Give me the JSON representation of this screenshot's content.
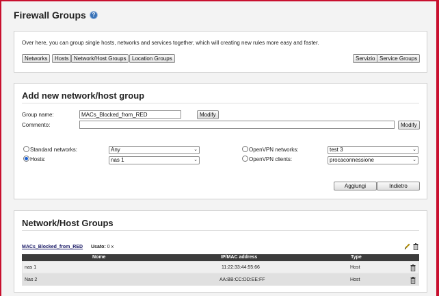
{
  "page": {
    "title": "Firewall Groups",
    "help_symbol": "?"
  },
  "intro": {
    "text": "Over here, you can group single hosts, networks and services together, which will creating new rules more easy and faster.",
    "left_buttons": [
      "Networks",
      "Hosts",
      "Network/Host Groups",
      "Location Groups"
    ],
    "right_buttons": [
      "Servizio",
      "Service Groups"
    ]
  },
  "add_group": {
    "title": "Add new network/host group",
    "group_name_label": "Group name:",
    "group_name_value": "MACs_Blocked_from_RED",
    "modify_label": "Modify",
    "comment_label": "Commento:",
    "comment_value": "",
    "comment_modify_label": "Modify",
    "standard_networks_label": "Standard networks:",
    "standard_networks_value": "Any",
    "hosts_label": "Hosts:",
    "hosts_value": "nas 1",
    "openvpn_networks_label": "OpenVPN networks:",
    "openvpn_networks_value": "test 3",
    "openvpn_clients_label": "OpenVPN clients:",
    "openvpn_clients_value": "procaconnessione",
    "selected_source": "hosts",
    "add_label": "Aggiungi",
    "back_label": "Indietro"
  },
  "groups": {
    "title": "Network/Host Groups",
    "group_name": "MACs_Blocked_from_RED",
    "usage_label": "Usato:",
    "usage_value": "0 x",
    "columns": [
      "Nome",
      "IP/MAC address",
      "Type"
    ],
    "rows": [
      {
        "name": "nas 1",
        "address": "11:22:33:44:55:66",
        "type": "Host"
      },
      {
        "name": "Nas 2",
        "address": "AA:BB:CC:DD:EE:FF",
        "type": "Host"
      }
    ]
  },
  "colors": {
    "accent": "#c8102e",
    "table_header": "#3c3c3c",
    "help_icon": "#3a73b7"
  }
}
